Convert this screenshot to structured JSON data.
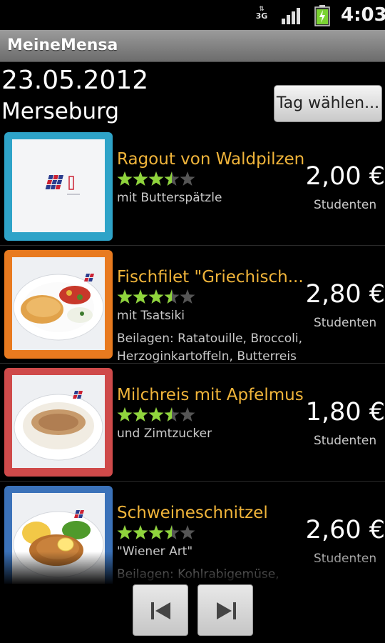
{
  "status_bar": {
    "network": "3G",
    "time": "4:03"
  },
  "app": {
    "title": "MeineMensa"
  },
  "header": {
    "date": "23.05.2012",
    "location": "Merseburg",
    "day_button_label": "Tag wählen..."
  },
  "meals": [
    {
      "name": "Ragout von Waldpilzen",
      "rating": 3.5,
      "description": "mit Butterspätzle",
      "sides": "",
      "price": "2,00 €",
      "price_label": "Studenten",
      "frame_color": "#2ea3c8",
      "image": "placeholder-logo"
    },
    {
      "name": "Fischfilet \"Griechisch...",
      "rating": 3.5,
      "description": "mit Tsatsiki",
      "sides": "Beilagen: Ratatouille, Broccoli, Herzoginkartoffeln, Butterreis",
      "price": "2,80 €",
      "price_label": "Studenten",
      "frame_color": "#e87a1f",
      "image": "fish-plate"
    },
    {
      "name": "Milchreis mit Apfelmus",
      "rating": 3.5,
      "description": "und Zimtzucker",
      "sides": "",
      "price": "1,80 €",
      "price_label": "Studenten",
      "frame_color": "#cf4a4a",
      "image": "rice-plate"
    },
    {
      "name": "Schweineschnitzel",
      "rating": 3.5,
      "description": "\"Wiener Art\"",
      "sides": "Beilagen: Kohlrabigemüse, Buttererbsen, Kartoffeln,",
      "price": "2,60 €",
      "price_label": "Studenten",
      "frame_color": "#3b72b9",
      "image": "schnitzel-plate"
    }
  ],
  "navigation": {
    "prev_icon": "skip-previous-icon",
    "next_icon": "skip-next-icon"
  },
  "colors": {
    "meal_name": "#f0b43a",
    "star_filled": "#8fd43c",
    "star_empty": "#555555"
  }
}
